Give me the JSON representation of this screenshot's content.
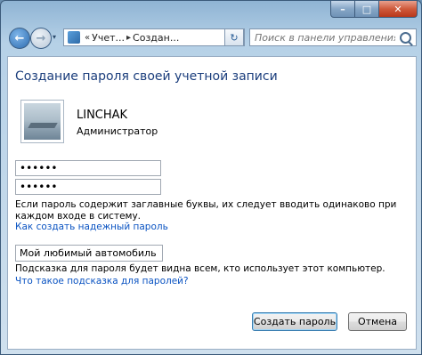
{
  "window": {
    "caption": {
      "minimize": "–",
      "maximize": "□",
      "close": "✕"
    }
  },
  "nav": {
    "back_icon": "←",
    "forward_icon": "→",
    "dropdown_icon": "▾",
    "address": {
      "segments": [
        "Учет...",
        "Создан..."
      ],
      "sep_first": "«",
      "sep": "▸"
    },
    "refresh_icon": "↻",
    "search_placeholder": "Поиск в панели управления"
  },
  "content": {
    "title": "Создание пароля своей учетной записи",
    "user": {
      "name": "LINCHAK",
      "role": "Администратор"
    },
    "password_value": "••••••",
    "confirm_value": "••••••",
    "case_note": "Если пароль содержит заглавные буквы, их следует вводить одинаково при каждом входе в систему.",
    "strong_password_link": "Как создать надежный пароль",
    "hint_value": "Мой любимый автомобиль",
    "hint_note": "Подсказка для пароля будет видна всем, кто использует этот компьютер.",
    "hint_link": "Что такое подсказка для паролей?",
    "create_button": "Создать пароль",
    "cancel_button": "Отмена"
  }
}
